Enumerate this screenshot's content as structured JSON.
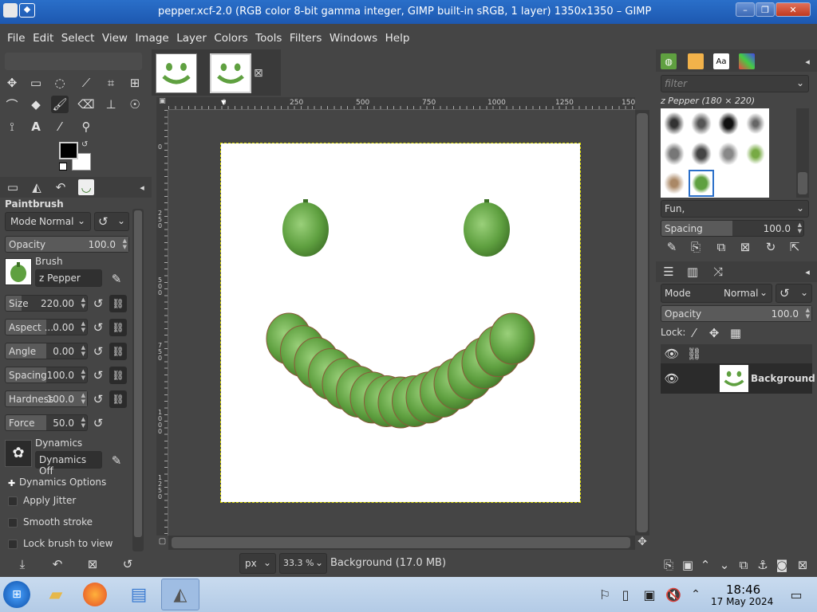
{
  "window": {
    "title": "pepper.xcf-2.0 (RGB color 8-bit gamma integer, GIMP built-in sRGB, 1 layer) 1350x1350 – GIMP",
    "minimize": "–",
    "maximize": "❐",
    "close": "✕"
  },
  "menu": [
    "File",
    "Edit",
    "Select",
    "View",
    "Image",
    "Layer",
    "Colors",
    "Tools",
    "Filters",
    "Windows",
    "Help"
  ],
  "tool_options": {
    "heading": "Paintbrush",
    "mode_label": "Mode",
    "mode_value": "Normal",
    "opacity": {
      "label": "Opacity",
      "value": "100.0",
      "fraction": 1.0
    },
    "brush_label": "Brush",
    "brush_name": "z Pepper",
    "size": {
      "label": "Size",
      "value": "220.00",
      "fraction": 0.2
    },
    "aspect": {
      "label": "Aspect ...",
      "value": "0.00",
      "fraction": 0.5
    },
    "angle": {
      "label": "Angle",
      "value": "0.00",
      "fraction": 0.5
    },
    "spacing": {
      "label": "Spacing",
      "value": "100.0",
      "fraction": 0.5
    },
    "hardness": {
      "label": "Hardness",
      "value": "100.0",
      "fraction": 1.0
    },
    "force": {
      "label": "Force",
      "value": "50.0",
      "fraction": 0.5
    },
    "dynamics_label": "Dynamics",
    "dynamics_value": "Dynamics Off",
    "dynamics_options": "Dynamics Options",
    "apply_jitter": "Apply Jitter",
    "smooth_stroke": "Smooth stroke",
    "lock_brush": "Lock brush to view"
  },
  "rulers": {
    "h_ticks": [
      "0",
      "250",
      "500",
      "750",
      "1000",
      "1250",
      "150"
    ],
    "v_ticks": [
      "0",
      "250",
      "500",
      "750",
      "1000",
      "1250"
    ]
  },
  "status": {
    "unit": "px",
    "zoom": "33.3 %",
    "layer_info": "Background (17.0 MB)"
  },
  "brushes": {
    "filter_placeholder": "filter",
    "selected": "z Pepper (180 × 220)",
    "tag": "Fun,",
    "spacing_label": "Spacing",
    "spacing_value": "100.0"
  },
  "layers": {
    "mode_label": "Mode",
    "mode_value": "Normal",
    "opacity_label": "Opacity",
    "opacity_value": "100.0",
    "lock_label": "Lock:",
    "layer_name": "Background"
  },
  "taskbar": {
    "time": "18:46",
    "date": "17 May 2024"
  },
  "colors": {
    "fg": "#000000",
    "bg": "#ffffff",
    "pepper": "#5fa040",
    "pepper_dark": "#3d7026",
    "titlebar": "#2266c4"
  }
}
